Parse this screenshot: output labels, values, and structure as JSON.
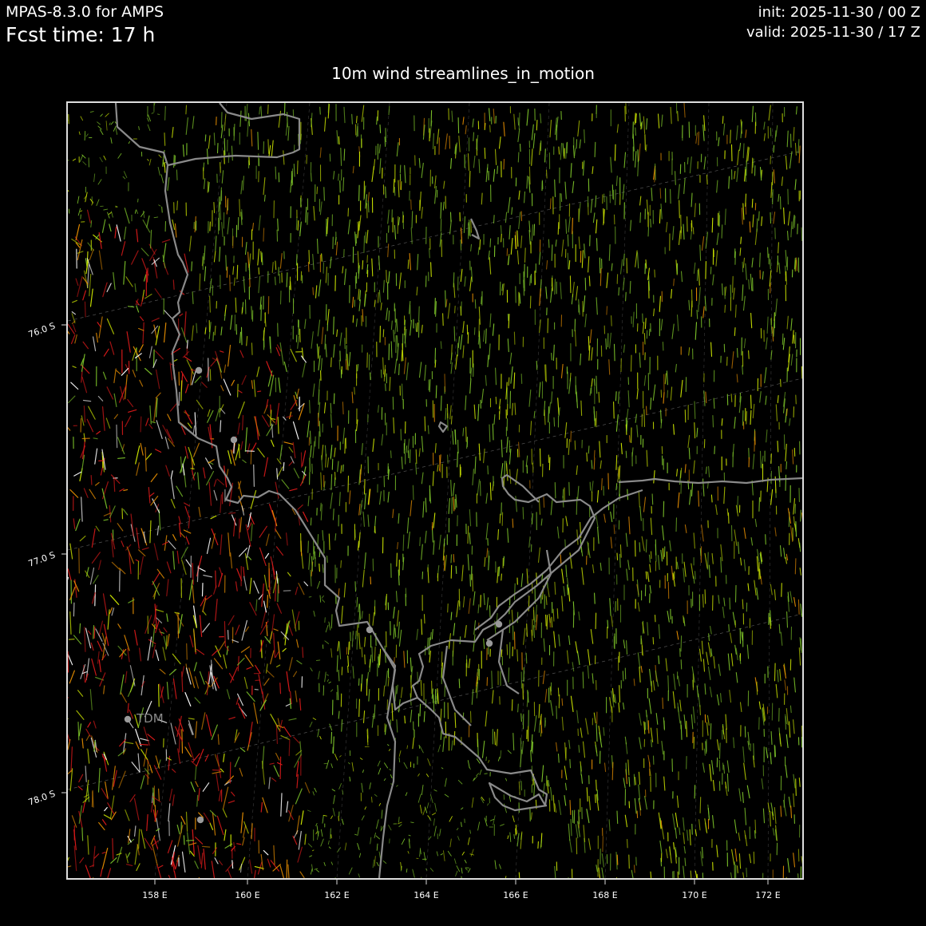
{
  "header": {
    "model": "MPAS-8.3.0 for AMPS",
    "fcst_time": "Fcst time:   17 h",
    "init": "init: 2025-11-30 / 00 Z",
    "valid": "valid: 2025-11-30 / 17 Z"
  },
  "map": {
    "title": "10m wind streamlines_in_motion",
    "lon_ticks": [
      "158 E",
      "160 E",
      "162 E",
      "164 E",
      "166 E",
      "168 E",
      "170 E",
      "172 E"
    ],
    "lat_ticks": [
      "76.0 S",
      "77.0 S",
      "78.0 S"
    ],
    "station_label": "TDM",
    "colors": {
      "background": "#000000",
      "coastline": "#8a8a8a",
      "graticule": "#555555",
      "wind_light": "#7dc42a",
      "wind_moderate": "#c8e000",
      "wind_strong_orange": "#e08a00",
      "wind_strong_red": "#d81a1a",
      "wind_extreme": "#ffffff",
      "station": "#9a9a9a"
    }
  }
}
